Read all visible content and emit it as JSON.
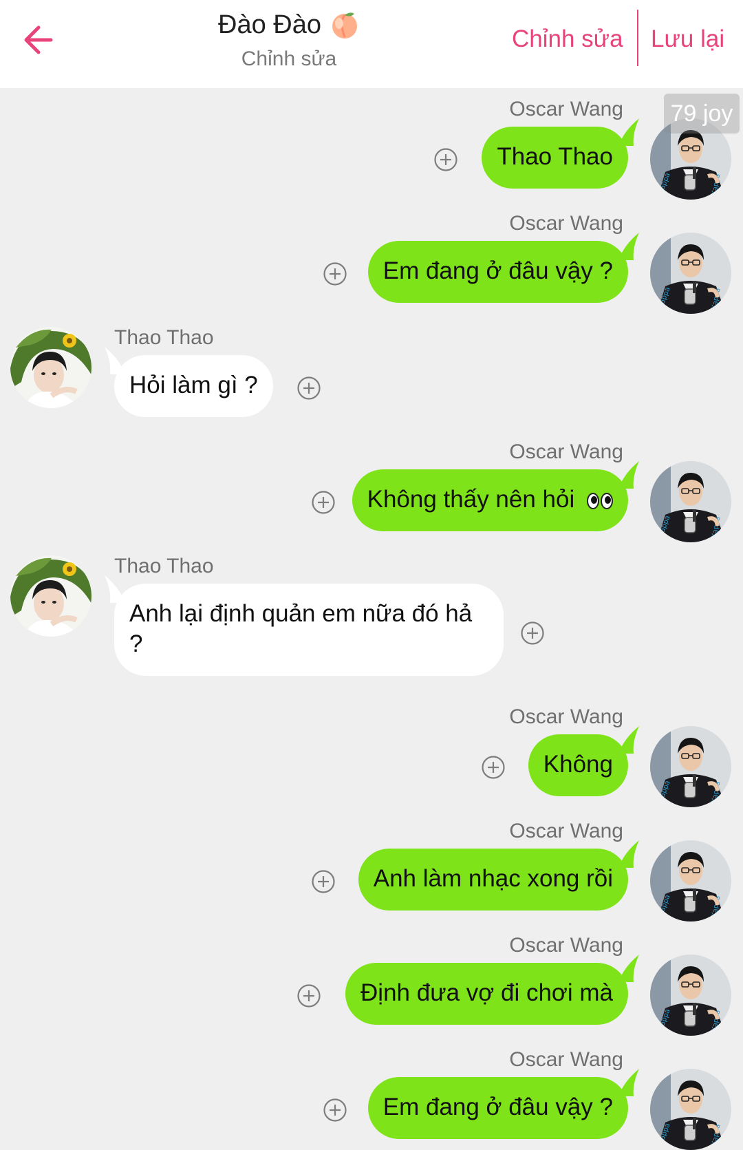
{
  "header": {
    "title": "Đào Đào",
    "title_emoji_icon": "peach-icon",
    "subtitle": "Chỉnh sửa",
    "edit_label": "Chỉnh sửa",
    "save_label": "Lưu lại",
    "back_icon": "arrow-left-icon"
  },
  "watermark": "79 joy",
  "colors": {
    "accent": "#e8437a",
    "sent_bubble": "#7fe319",
    "received_bubble": "#ffffff",
    "background": "#efefef"
  },
  "messages": [
    {
      "sender": "Oscar Wang",
      "side": "me",
      "text": "Thao Thao"
    },
    {
      "sender": "Oscar Wang",
      "side": "me",
      "text": "Em đang ở đâu vậy ?"
    },
    {
      "sender": "Thao Thao",
      "side": "them",
      "text": "Hỏi làm gì ?"
    },
    {
      "sender": "Oscar Wang",
      "side": "me",
      "text": "Không thấy nên hỏi",
      "emoji_icon": "eyes-icon"
    },
    {
      "sender": "Thao Thao",
      "side": "them",
      "text": "Anh lại định quản em nữa đó hả ?"
    },
    {
      "sender": "Oscar Wang",
      "side": "me",
      "text": "Không"
    },
    {
      "sender": "Oscar Wang",
      "side": "me",
      "text": "Anh làm nhạc xong rồi"
    },
    {
      "sender": "Oscar Wang",
      "side": "me",
      "text": "Định đưa vợ đi chơi mà"
    },
    {
      "sender": "Oscar Wang",
      "side": "me",
      "text": "Em đang ở đâu vậy ?"
    }
  ]
}
